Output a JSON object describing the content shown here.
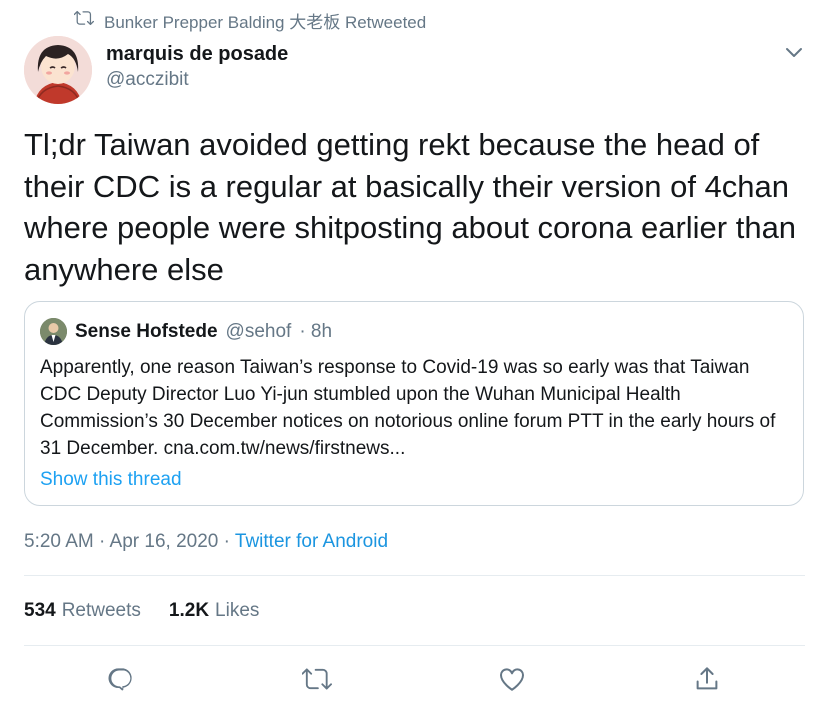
{
  "retweet_banner": {
    "text": "Bunker Prepper Balding 大老板 Retweeted"
  },
  "author": {
    "name": "marquis de posade",
    "handle": "@acczibit"
  },
  "tweet": {
    "text": "Tl;dr Taiwan avoided getting rekt because the head of their CDC is a regular at basically their version of 4chan where people were shitposting about corona earlier than anywhere else"
  },
  "quoted_tweet": {
    "name": "Sense Hofstede",
    "handle": "@sehof",
    "time": "· 8h",
    "text": "Apparently, one reason Taiwan’s response to Covid-19 was so early was that Taiwan CDC Deputy Director Luo Yi-jun stumbled upon the Wuhan Municipal Health Commission’s 30 December notices on notorious online forum PTT in the early hours of 31 December. cna.com.tw/news/firstnews...",
    "show_thread_label": "Show this thread"
  },
  "meta": {
    "timestamp": "5:20 AM · Apr 16, 2020 · ",
    "source": "Twitter for Android"
  },
  "stats": {
    "retweets_count": "534",
    "retweets_label": "Retweets",
    "likes_count": "1.2K",
    "likes_label": "Likes"
  },
  "colors": {
    "accent": "#1da1f2",
    "muted": "#657786",
    "border": "#ccd6dd"
  },
  "icons": [
    "retweet-icon",
    "chevron-down-icon",
    "reply-icon",
    "retweet-icon",
    "like-icon",
    "share-icon"
  ]
}
